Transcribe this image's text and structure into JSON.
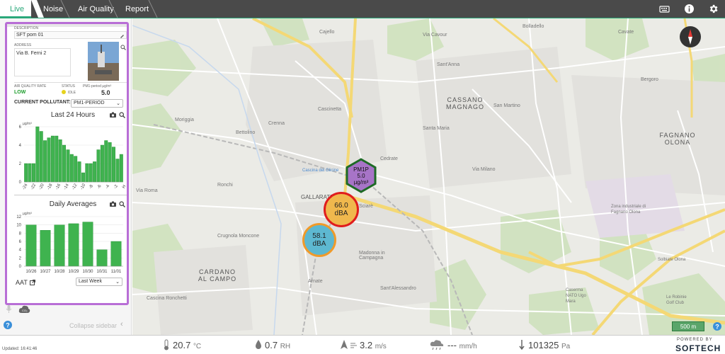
{
  "tabs": [
    {
      "label": "Live"
    },
    {
      "label": "Noise"
    },
    {
      "label": "Air Quality"
    },
    {
      "label": "Report"
    }
  ],
  "sensor": {
    "description_label": "DESCRIPTION",
    "description": "SFT pom 01",
    "address_label": "ADDRESS",
    "address": "Via B. Ferni 2",
    "aq_rate_label": "AIR QUALITY RATE",
    "status_label": "STATUS",
    "pollutant_col_label": "PM1-period µg/m³",
    "aq_rate": "LOW",
    "status": "IDLE",
    "value": "5.0",
    "current_pollutant_label": "CURRENT POLLUTANT:",
    "current_pollutant": "PM1-PERIOD"
  },
  "chart24": {
    "title": "Last 24 Hours",
    "unit": "µg/m³"
  },
  "chartDaily": {
    "title": "Daily Averages",
    "unit": "µg/m³"
  },
  "chart_data": [
    {
      "type": "bar",
      "title": "Last 24 Hours",
      "ylabel": "µg/m³",
      "ylim": [
        0,
        6
      ],
      "yticks": [
        "6",
        "4",
        "2",
        "0"
      ],
      "xticks": [
        "-24",
        "-22",
        "-20",
        "-18",
        "-16",
        "-14",
        "-12",
        "-10",
        "-8",
        "-6",
        "-4",
        "-2",
        "H"
      ],
      "values": [
        2,
        2,
        2,
        6,
        5.5,
        4.5,
        4.8,
        5,
        5,
        4.6,
        4,
        3.5,
        3,
        2.8,
        2.2,
        1,
        2,
        2,
        2.2,
        3.5,
        4,
        4.5,
        4.3,
        3.8,
        2.5,
        3
      ]
    },
    {
      "type": "bar",
      "title": "Daily Averages",
      "ylabel": "µg/m³",
      "ylim": [
        0,
        12
      ],
      "yticks": [
        "12",
        "10",
        "8",
        "6",
        "4",
        "2",
        "0"
      ],
      "categories": [
        "10/26",
        "10/27",
        "10/28",
        "10/29",
        "10/30",
        "10/31",
        "11/01"
      ],
      "values": [
        10,
        8.7,
        10,
        10.3,
        10.7,
        4,
        6
      ]
    }
  ],
  "aat_label": "AAT",
  "period_select": "Last Week",
  "collapse_label": "Collapse sidebar",
  "updated": "Updated: 16:41:46",
  "markers": [
    {
      "line1": "PM1P",
      "line2": "5.0",
      "line3": "µg/m³"
    },
    {
      "line1": "66.0",
      "line2": "dBA"
    },
    {
      "line1": "58.1",
      "line2": "dBA"
    }
  ],
  "map_labels": [
    "CASSANO MAGNAGO",
    "FAGNANO OLONA",
    "GALLARATE",
    "CARDANO AL CAMPO",
    "Moriggia",
    "Crenna",
    "Cascinetta",
    "Bettolino",
    "Ronchi",
    "Cedrate",
    "Cascina del Glicine",
    "Sciarè",
    "Cajello",
    "Bolladello",
    "Cavate",
    "Santa Maria",
    "San Martino",
    "Sant'Anna",
    "Bergoro",
    "Zona industriale di Fagnano Olona",
    "Madonna in Campagna",
    "Sant'Alessandro",
    "Arnate",
    "Crugnola Moncone",
    "Cascina Ronchetti",
    "Via Roma",
    "Via Cavour",
    "Solbiate Olona",
    "Caserma NATO Ugo Mara",
    "Le Robinie Golf Club",
    "Via Milano"
  ],
  "scale_label": "500 m",
  "weather": {
    "temp": "20.7",
    "temp_unit": "°C",
    "rh": "0.7",
    "rh_unit": "RH",
    "wind": "3.2",
    "wind_unit": "m/s",
    "rain": "---",
    "rain_unit": "mm/h",
    "pressure": "101325",
    "pressure_unit": "Pa"
  },
  "brand": {
    "powered": "POWERED BY",
    "name": "SOFTECH"
  }
}
